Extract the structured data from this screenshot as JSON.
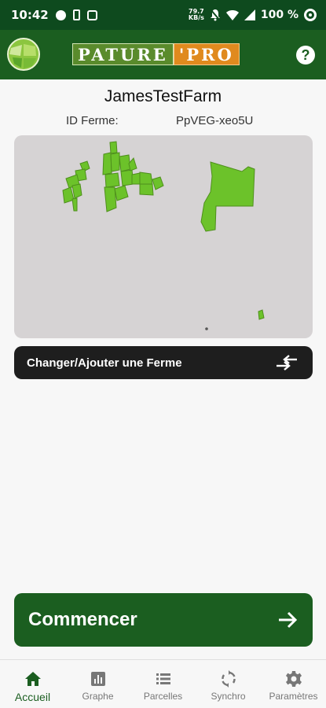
{
  "status_bar": {
    "time": "10:42",
    "data_rate_top": "79.7",
    "data_rate_bottom": "KB/s",
    "battery": "100 %"
  },
  "app_bar": {
    "brand_part1": "PATURE",
    "brand_part2": "'PRO",
    "help_label": "?"
  },
  "farm": {
    "name": "JamesTestFarm",
    "id_label": "ID Ferme:",
    "id_value": "PpVEG-xeo5U"
  },
  "map": {
    "background": "#d6d3d4",
    "parcel_fill": "#6cc22a",
    "parcel_stroke": "#4e8f1c"
  },
  "change_farm_button": {
    "label": "Changer/Ajouter une Ferme",
    "icon": "swap-arrows-icon"
  },
  "start_button": {
    "label": "Commencer",
    "icon": "arrow-right-icon"
  },
  "nav": [
    {
      "label": "Accueil",
      "icon": "home-icon",
      "active": true
    },
    {
      "label": "Graphe",
      "icon": "bar-chart-icon",
      "active": false
    },
    {
      "label": "Parcelles",
      "icon": "list-icon",
      "active": false
    },
    {
      "label": "Synchro",
      "icon": "sync-icon",
      "active": false
    },
    {
      "label": "Paramètres",
      "icon": "gear-icon",
      "active": false
    }
  ],
  "colors": {
    "primary": "#1b5e20",
    "dark_button": "#1e1e1e",
    "accent_orange": "#e08a1e"
  }
}
